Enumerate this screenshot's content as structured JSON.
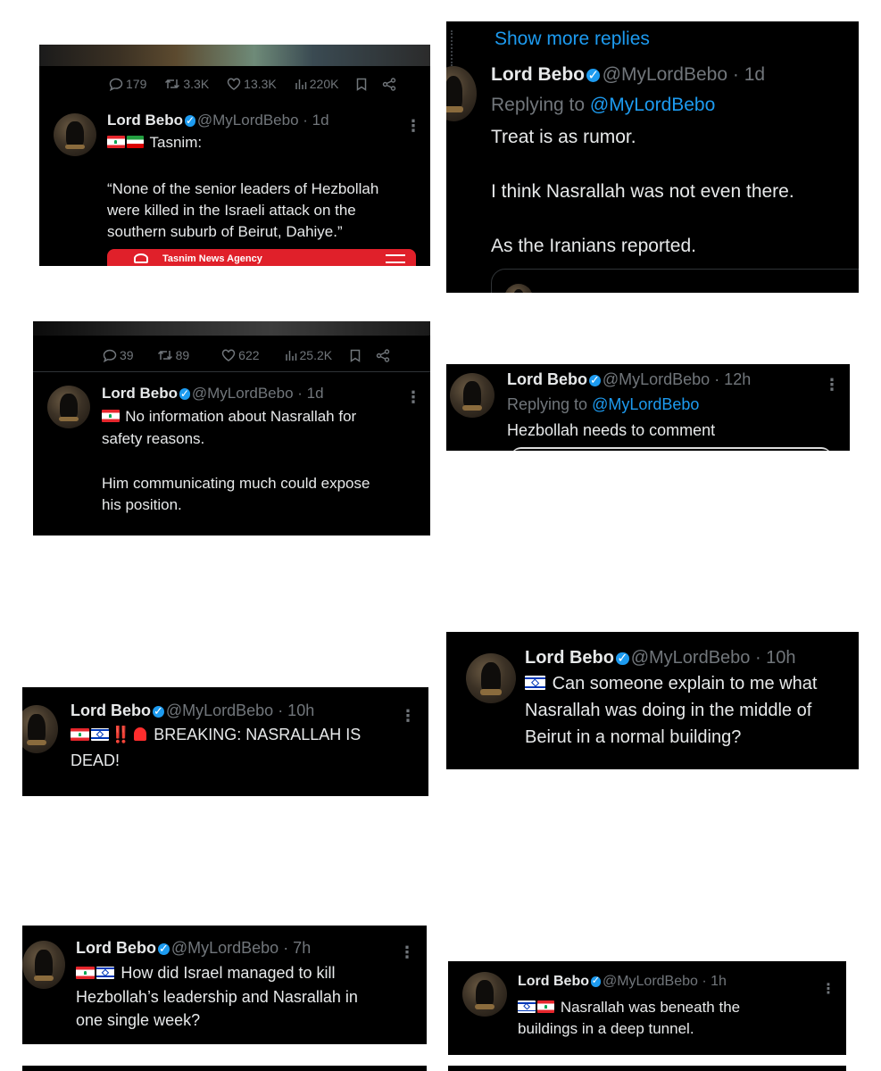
{
  "author": {
    "name": "Lord Bebo",
    "handle": "@MyLordBebo"
  },
  "more_icon": "⋮",
  "card1": {
    "stats": {
      "replies": "179",
      "reposts": "3.3K",
      "likes": "13.3K",
      "views": "220K"
    },
    "time": "· 1d",
    "line1": "Tasnim:",
    "quote1": "“None of the senior leaders of Hezbollah",
    "quote2": "were killed in the Israeli attack on the",
    "quote3": "southern suburb of Beirut, Dahiye.”",
    "link_card_label": "Tasnim News Agency"
  },
  "card2": {
    "show_more": "Show more replies",
    "time": "· 1d",
    "replying_prefix": "Replying to",
    "replying_handle": "@MyLordBebo",
    "line1": "Treat is as rumor.",
    "line2": "I think Nasrallah was not even there.",
    "line3": "As the Iranians reported."
  },
  "card3": {
    "stats": {
      "replies": "39",
      "reposts": "89",
      "likes": "622",
      "views": "25.2K"
    },
    "time": "· 1d",
    "line1": "No information about Nasrallah for",
    "line2": "safety reasons.",
    "line3": "Him communicating much could expose",
    "line4": "his position."
  },
  "card4": {
    "time": "· 12h",
    "replying_prefix": "Replying to",
    "replying_handle": "@MyLordBebo",
    "line1": "Hezbollah needs to comment"
  },
  "card5": {
    "time": "· 10h",
    "line1": "Can someone explain to me what",
    "line2": "Nasrallah was doing in the middle of",
    "line3": "Beirut in a normal building?"
  },
  "card6": {
    "time": "· 10h",
    "bang": "‼️",
    "line1": "BREAKING: NASRALLAH IS",
    "line2": "DEAD!"
  },
  "card7": {
    "time": "· 7h",
    "line1": "How did Israel managed to kill",
    "line2": "Hezbollah’s leadership and Nasrallah in",
    "line3": "one single week?"
  },
  "card8": {
    "time": "· 1h",
    "line1": "Nasrallah was beneath the",
    "line2": "buildings in a deep tunnel."
  },
  "colors": {
    "card_bg": "#000000",
    "text": "#e7e9ea",
    "muted": "#71767b",
    "accent_blue": "#1d9bf0",
    "tasnim_red": "#e0202a"
  }
}
